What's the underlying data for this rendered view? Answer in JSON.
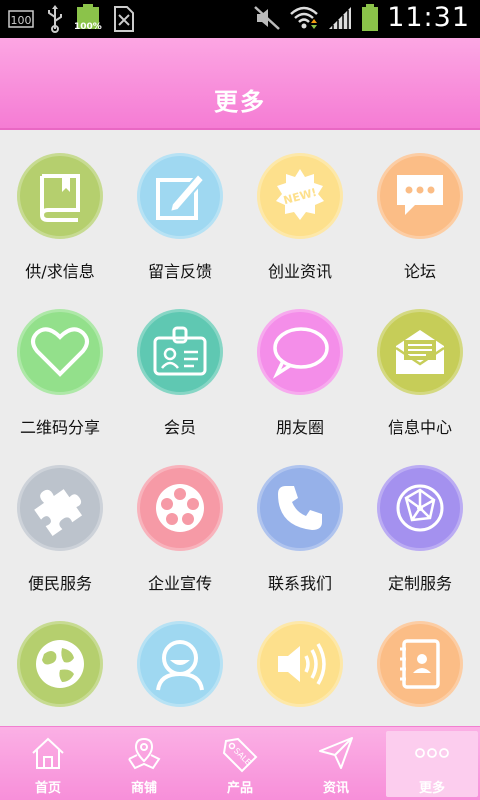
{
  "status_bar": {
    "time": "11:31",
    "battery_percent_label": "100%",
    "storage_badge": "100",
    "icons": [
      "storage-100-icon",
      "usb-icon",
      "battery-charging-icon",
      "signal-off-phone-icon",
      "mute-icon",
      "wifi-icon",
      "cell-signal-icon",
      "battery-icon"
    ]
  },
  "header": {
    "title": "更多"
  },
  "grid": {
    "items": [
      {
        "label": "供/求信息",
        "icon": "book-icon",
        "color": "#b5cf6e"
      },
      {
        "label": "留言反馈",
        "icon": "edit-note-icon",
        "color": "#9fd8f1"
      },
      {
        "label": "创业资讯",
        "icon": "new-badge-icon",
        "color": "#fde08c"
      },
      {
        "label": "论坛",
        "icon": "chat-bubble-icon",
        "color": "#fbbd86"
      },
      {
        "label": "二维码分享",
        "icon": "heart-icon",
        "color": "#93e08b"
      },
      {
        "label": "会员",
        "icon": "id-badge-icon",
        "color": "#5fc8b2"
      },
      {
        "label": "朋友圈",
        "icon": "speech-bubble-icon",
        "color": "#f48ee9"
      },
      {
        "label": "信息中心",
        "icon": "open-envelope-icon",
        "color": "#c6cd58"
      },
      {
        "label": "便民服务",
        "icon": "puzzle-icon",
        "color": "#bcc3cc"
      },
      {
        "label": "企业宣传",
        "icon": "film-reel-icon",
        "color": "#f69aa6"
      },
      {
        "label": "联系我们",
        "icon": "phone-icon",
        "color": "#96b1e9"
      },
      {
        "label": "定制服务",
        "icon": "network-globe-icon",
        "color": "#a491ef"
      },
      {
        "label": "",
        "icon": "globe-icon",
        "color": "#b5cf6e"
      },
      {
        "label": "",
        "icon": "smiley-user-icon",
        "color": "#9fd8f1"
      },
      {
        "label": "",
        "icon": "speaker-icon",
        "color": "#fde08c"
      },
      {
        "label": "",
        "icon": "contact-book-icon",
        "color": "#fbbd86"
      }
    ]
  },
  "tabbar": {
    "tabs": [
      {
        "label": "首页",
        "icon": "home-icon",
        "active": false
      },
      {
        "label": "商铺",
        "icon": "shop-map-icon",
        "active": false
      },
      {
        "label": "产品",
        "icon": "sale-tag-icon",
        "active": false
      },
      {
        "label": "资讯",
        "icon": "send-plane-icon",
        "active": false
      },
      {
        "label": "更多",
        "icon": "more-dots-icon",
        "active": true
      }
    ]
  }
}
